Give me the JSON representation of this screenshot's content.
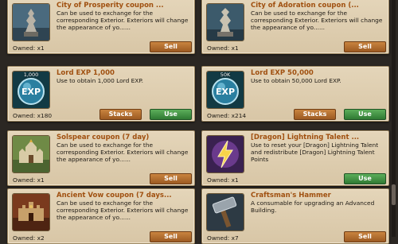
{
  "items": [
    {
      "title": "City of Prosperity coupon ...",
      "desc": "Can be used to exchange for the corresponding Exterior. Exteriors will change the appearance of yo......",
      "owned": "Owned: x1",
      "buttons": [
        {
          "type": "sell",
          "label": "Sell"
        }
      ],
      "icon": "prosperity-statue-icon",
      "badge": ""
    },
    {
      "title": "City of Adoration coupon (...",
      "desc": "Can be used to exchange for the corresponding Exterior. Exteriors will change the appearance of yo......",
      "owned": "Owned: x1",
      "buttons": [
        {
          "type": "sell",
          "label": "Sell"
        }
      ],
      "icon": "adoration-statue-icon",
      "badge": ""
    },
    {
      "title": "Lord EXP 1,000",
      "desc": "Use to obtain 1,000 Lord EXP.",
      "owned": "Owned: x180",
      "buttons": [
        {
          "type": "stacks",
          "label": "Stacks"
        },
        {
          "type": "use",
          "label": "Use"
        }
      ],
      "icon": "exp-orb-icon",
      "badge": "1,000"
    },
    {
      "title": "Lord EXP 50,000",
      "desc": "Use to obtain 50,000 Lord EXP.",
      "owned": "Owned: x214",
      "buttons": [
        {
          "type": "stacks",
          "label": "Stacks"
        },
        {
          "type": "use",
          "label": "Use"
        }
      ],
      "icon": "exp-orb-icon",
      "badge": "50K"
    },
    {
      "title": "Solspear coupon (7 day)",
      "desc": "Can be used to exchange for the corresponding Exterior. Exteriors will change the appearance of yo......",
      "owned": "Owned: x1",
      "buttons": [
        {
          "type": "sell",
          "label": "Sell"
        }
      ],
      "icon": "solspear-castle-icon",
      "badge": ""
    },
    {
      "title": "[Dragon] Lightning Talent ...",
      "desc": "Use to reset your [Dragon] Lightning Talent and redistribute [Dragon] Lightning Talent Points",
      "owned": "Owned: x1",
      "buttons": [
        {
          "type": "use",
          "label": "Use"
        }
      ],
      "icon": "lightning-talent-icon",
      "badge": ""
    },
    {
      "title": "Ancient Vow coupon (7 days...",
      "desc": "Can be used to exchange for the corresponding Exterior. Exteriors will change the appearance of yo......",
      "owned": "Owned: x2",
      "buttons": [
        {
          "type": "sell",
          "label": "Sell"
        }
      ],
      "icon": "ancient-vow-castle-icon",
      "badge": ""
    },
    {
      "title": "Craftsman's Hammer",
      "desc": "A consumable for upgrading an Advanced Building.",
      "owned": "Owned: x7",
      "buttons": [
        {
          "type": "sell",
          "label": "Sell"
        }
      ],
      "icon": "hammer-icon",
      "badge": ""
    }
  ]
}
